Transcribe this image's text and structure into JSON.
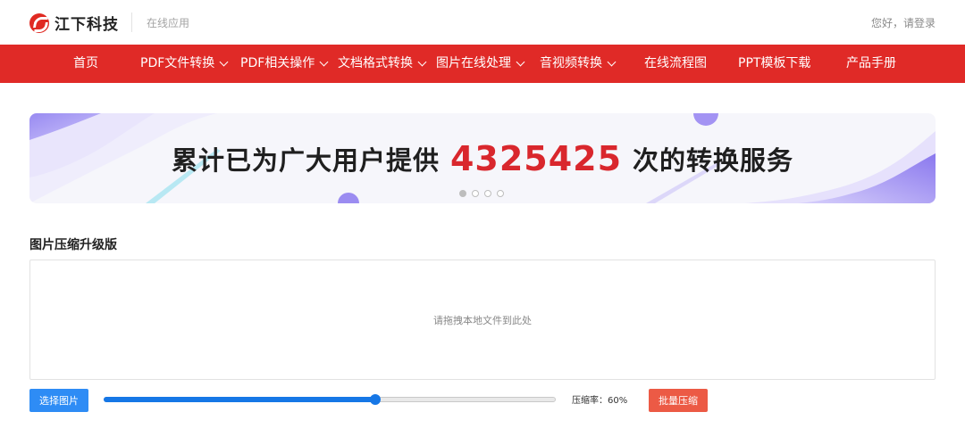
{
  "header": {
    "brand": "江下科技",
    "subtitle": "在线应用",
    "login": "您好，请登录"
  },
  "nav": {
    "items": [
      {
        "label": "首页",
        "dropdown": false
      },
      {
        "label": "PDF文件转换",
        "dropdown": true
      },
      {
        "label": "PDF相关操作",
        "dropdown": true
      },
      {
        "label": "文档格式转换",
        "dropdown": true
      },
      {
        "label": "图片在线处理",
        "dropdown": true
      },
      {
        "label": "音视频转换",
        "dropdown": true
      },
      {
        "label": "在线流程图",
        "dropdown": false
      },
      {
        "label": "PPT模板下载",
        "dropdown": false
      },
      {
        "label": "产品手册",
        "dropdown": false
      }
    ]
  },
  "banner": {
    "text_before": "累计已为广大用户提供",
    "count": "4325425",
    "text_after": "次的转换服务",
    "slide_count": 4,
    "active_slide": 1
  },
  "tool": {
    "title": "图片压缩升级版",
    "dropzone_hint": "请拖拽本地文件到此处",
    "select_button": "选择图片",
    "ratio_label": "压缩率：60%",
    "ratio_value": 60,
    "batch_button": "批量压缩"
  },
  "colors": {
    "nav_bg": "#e02a27",
    "primary_blue": "#2e8cf5",
    "slider_blue": "#1677e6",
    "batch_orange": "#ec5a45",
    "banner_number": "#d9272d"
  }
}
